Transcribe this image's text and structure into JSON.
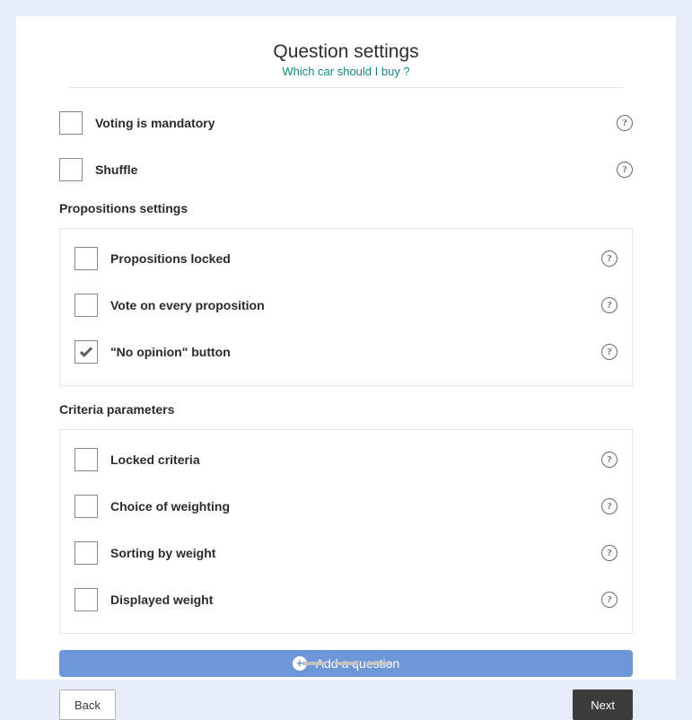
{
  "title": "Question settings",
  "subtitle": "Which car should I buy ?",
  "top_options": [
    {
      "label": "Voting is mandatory",
      "checked": false
    },
    {
      "label": "Shuffle",
      "checked": false
    }
  ],
  "propositions_section": {
    "title": "Propositions settings",
    "options": [
      {
        "label": "Propositions locked",
        "checked": false
      },
      {
        "label": "Vote on every proposition",
        "checked": false
      },
      {
        "label": "\"No opinion\" button",
        "checked": true
      }
    ]
  },
  "criteria_section": {
    "title": "Criteria parameters",
    "options": [
      {
        "label": "Locked criteria",
        "checked": false
      },
      {
        "label": "Choice of weighting",
        "checked": false
      },
      {
        "label": "Sorting by weight",
        "checked": false
      },
      {
        "label": "Displayed weight",
        "checked": false
      }
    ]
  },
  "add_button": "Add a question",
  "back_button": "Back",
  "next_button": "Next"
}
